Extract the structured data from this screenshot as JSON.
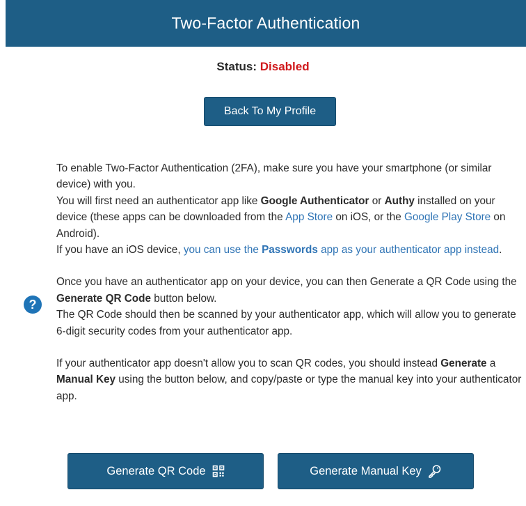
{
  "header": {
    "title": "Two-Factor Authentication"
  },
  "status": {
    "label": "Status:",
    "value": "Disabled"
  },
  "back_button": {
    "label": "Back To My Profile"
  },
  "help": {
    "icon": "question-circle-icon",
    "glyph": "?"
  },
  "instructions": {
    "p1": "To enable Two-Factor Authentication (2FA), make sure you have your smartphone (or similar device) with you.",
    "p2_a": "You will first need an authenticator app like ",
    "p2_ga": "Google Authenticator",
    "p2_or": " or ",
    "p2_authy": "Authy",
    "p2_b": " installed on your device (these apps can be downloaded from the ",
    "p2_appstore": "App Store",
    "p2_c": " on iOS, or the ",
    "p2_playstore": "Google Play Store",
    "p2_d": " on Android).",
    "p3_a": "If you have an iOS device, ",
    "p3_link_a": "you can use the ",
    "p3_link_b": "Passwords",
    "p3_link_c": " app as your authenticator app instead",
    "p3_end": ".",
    "p4_a": "Once you have an authenticator app on your device, you can then Generate a QR Code using the ",
    "p4_b": "Generate QR Code",
    "p4_c": " button below.",
    "p5": "The QR Code should then be scanned by your authenticator app, which will allow you to generate 6-digit security codes from your authenticator app.",
    "p6_a": "If your authenticator app doesn't allow you to scan QR codes, you should instead ",
    "p6_b": "Generate",
    "p6_c": " a ",
    "p6_d": "Manual Key",
    "p6_e": " using the button below, and copy/paste or type the manual key into your authenticator app."
  },
  "buttons": {
    "qr_label": "Generate QR Code",
    "qr_icon": "qr-code-icon",
    "key_label": "Generate Manual Key",
    "key_icon": "key-icon"
  },
  "colors": {
    "primary": "#1e5e86",
    "status_disabled": "#d0191c",
    "link": "#2f74b5",
    "help_icon": "#1f74b7"
  }
}
